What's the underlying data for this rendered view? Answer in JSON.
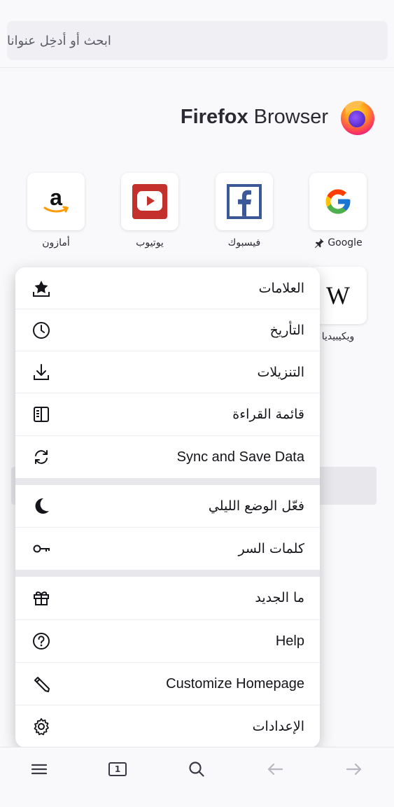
{
  "urlbar": {
    "placeholder": "ابحث أو أدخِل عنوانا"
  },
  "brand": {
    "name_bold": "Firefox",
    "name_light": "Browser"
  },
  "top_sites": [
    {
      "label": "Google",
      "pinned": true,
      "icon": "google-icon"
    },
    {
      "label": "فيسبوك",
      "icon": "facebook-icon"
    },
    {
      "label": "يوتيوب",
      "icon": "youtube-icon"
    },
    {
      "label": "أمازون",
      "icon": "amazon-icon"
    },
    {
      "label": "ويكيبيديا",
      "icon": "wikipedia-icon"
    }
  ],
  "menu": {
    "items": [
      {
        "label": "العلامات",
        "icon": "bookmark-star-icon"
      },
      {
        "label": "التأريخ",
        "icon": "clock-icon"
      },
      {
        "label": "التنزيلات",
        "icon": "download-icon"
      },
      {
        "label": "قائمة القراءة",
        "icon": "reading-list-icon"
      },
      {
        "label": "Sync and Save Data",
        "icon": "sync-icon"
      },
      {
        "label": "فعّل الوضع الليلي",
        "icon": "moon-icon"
      },
      {
        "label": "كلمات السر",
        "icon": "key-icon"
      },
      {
        "label": "ما الجديد",
        "icon": "gift-icon"
      },
      {
        "label": "Help",
        "icon": "help-icon"
      },
      {
        "label": "Customize Homepage",
        "icon": "pencil-icon"
      },
      {
        "label": "الإعدادات",
        "icon": "gear-icon"
      }
    ]
  },
  "toolbar": {
    "tab_count": "1"
  },
  "colors": {
    "accent": "#0060df",
    "menu_bg": "#ffffff",
    "page_bg": "#f9f9fb"
  }
}
